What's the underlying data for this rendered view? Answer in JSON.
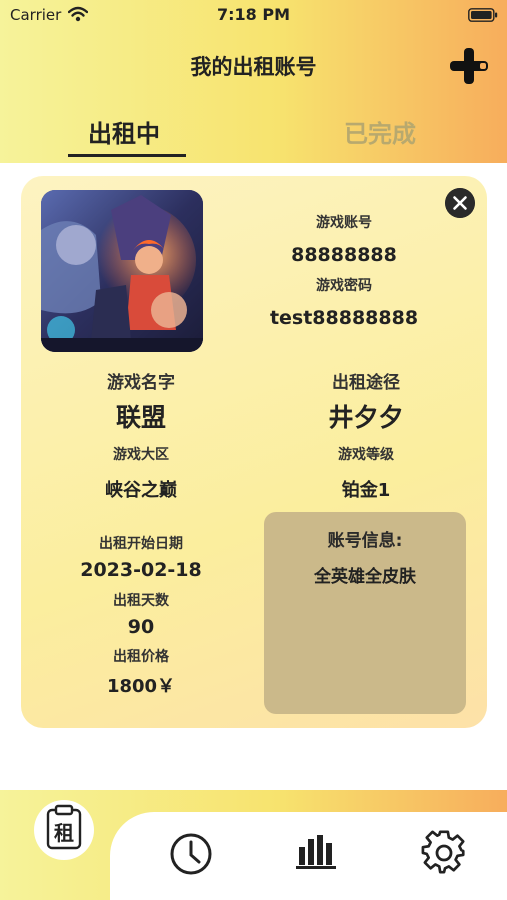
{
  "status_bar": {
    "carrier": "Carrier",
    "time": "7:18 PM"
  },
  "header": {
    "title": "我的出租账号"
  },
  "tabs": [
    {
      "label": "出租中",
      "active": true
    },
    {
      "label": "已完成",
      "active": false
    }
  ],
  "account": {
    "account_label": "游戏账号",
    "account_value": "88888888",
    "password_label": "游戏密码",
    "password_value": "test88888888",
    "game_name_label": "游戏名字",
    "game_name_value": "联盟",
    "channel_label": "出租途径",
    "channel_value": "井夕夕",
    "region_label": "游戏大区",
    "region_value": "峡谷之巅",
    "level_label": "游戏等级",
    "level_value": "铂金1",
    "start_label": "出租开始日期",
    "start_value": "2023-02-18",
    "days_label": "出租天数",
    "days_value": "90",
    "price_label": "出租价格",
    "price_value": "1800￥",
    "info_label": "账号信息:",
    "info_value": "全英雄全皮肤"
  },
  "bottom_nav": [
    {
      "icon": "rent-clipboard-icon",
      "glyph": "租",
      "active": true
    },
    {
      "icon": "clock-icon",
      "active": false
    },
    {
      "icon": "bar-chart-icon",
      "active": false
    },
    {
      "icon": "gear-icon",
      "active": false
    }
  ],
  "colors": {
    "gradient_start": "#f6f39a",
    "gradient_end": "#f7ad5c",
    "card_bg": "#fbee9e",
    "info_box": "#cbb98a",
    "inactive_tab": "#b8a96e"
  }
}
